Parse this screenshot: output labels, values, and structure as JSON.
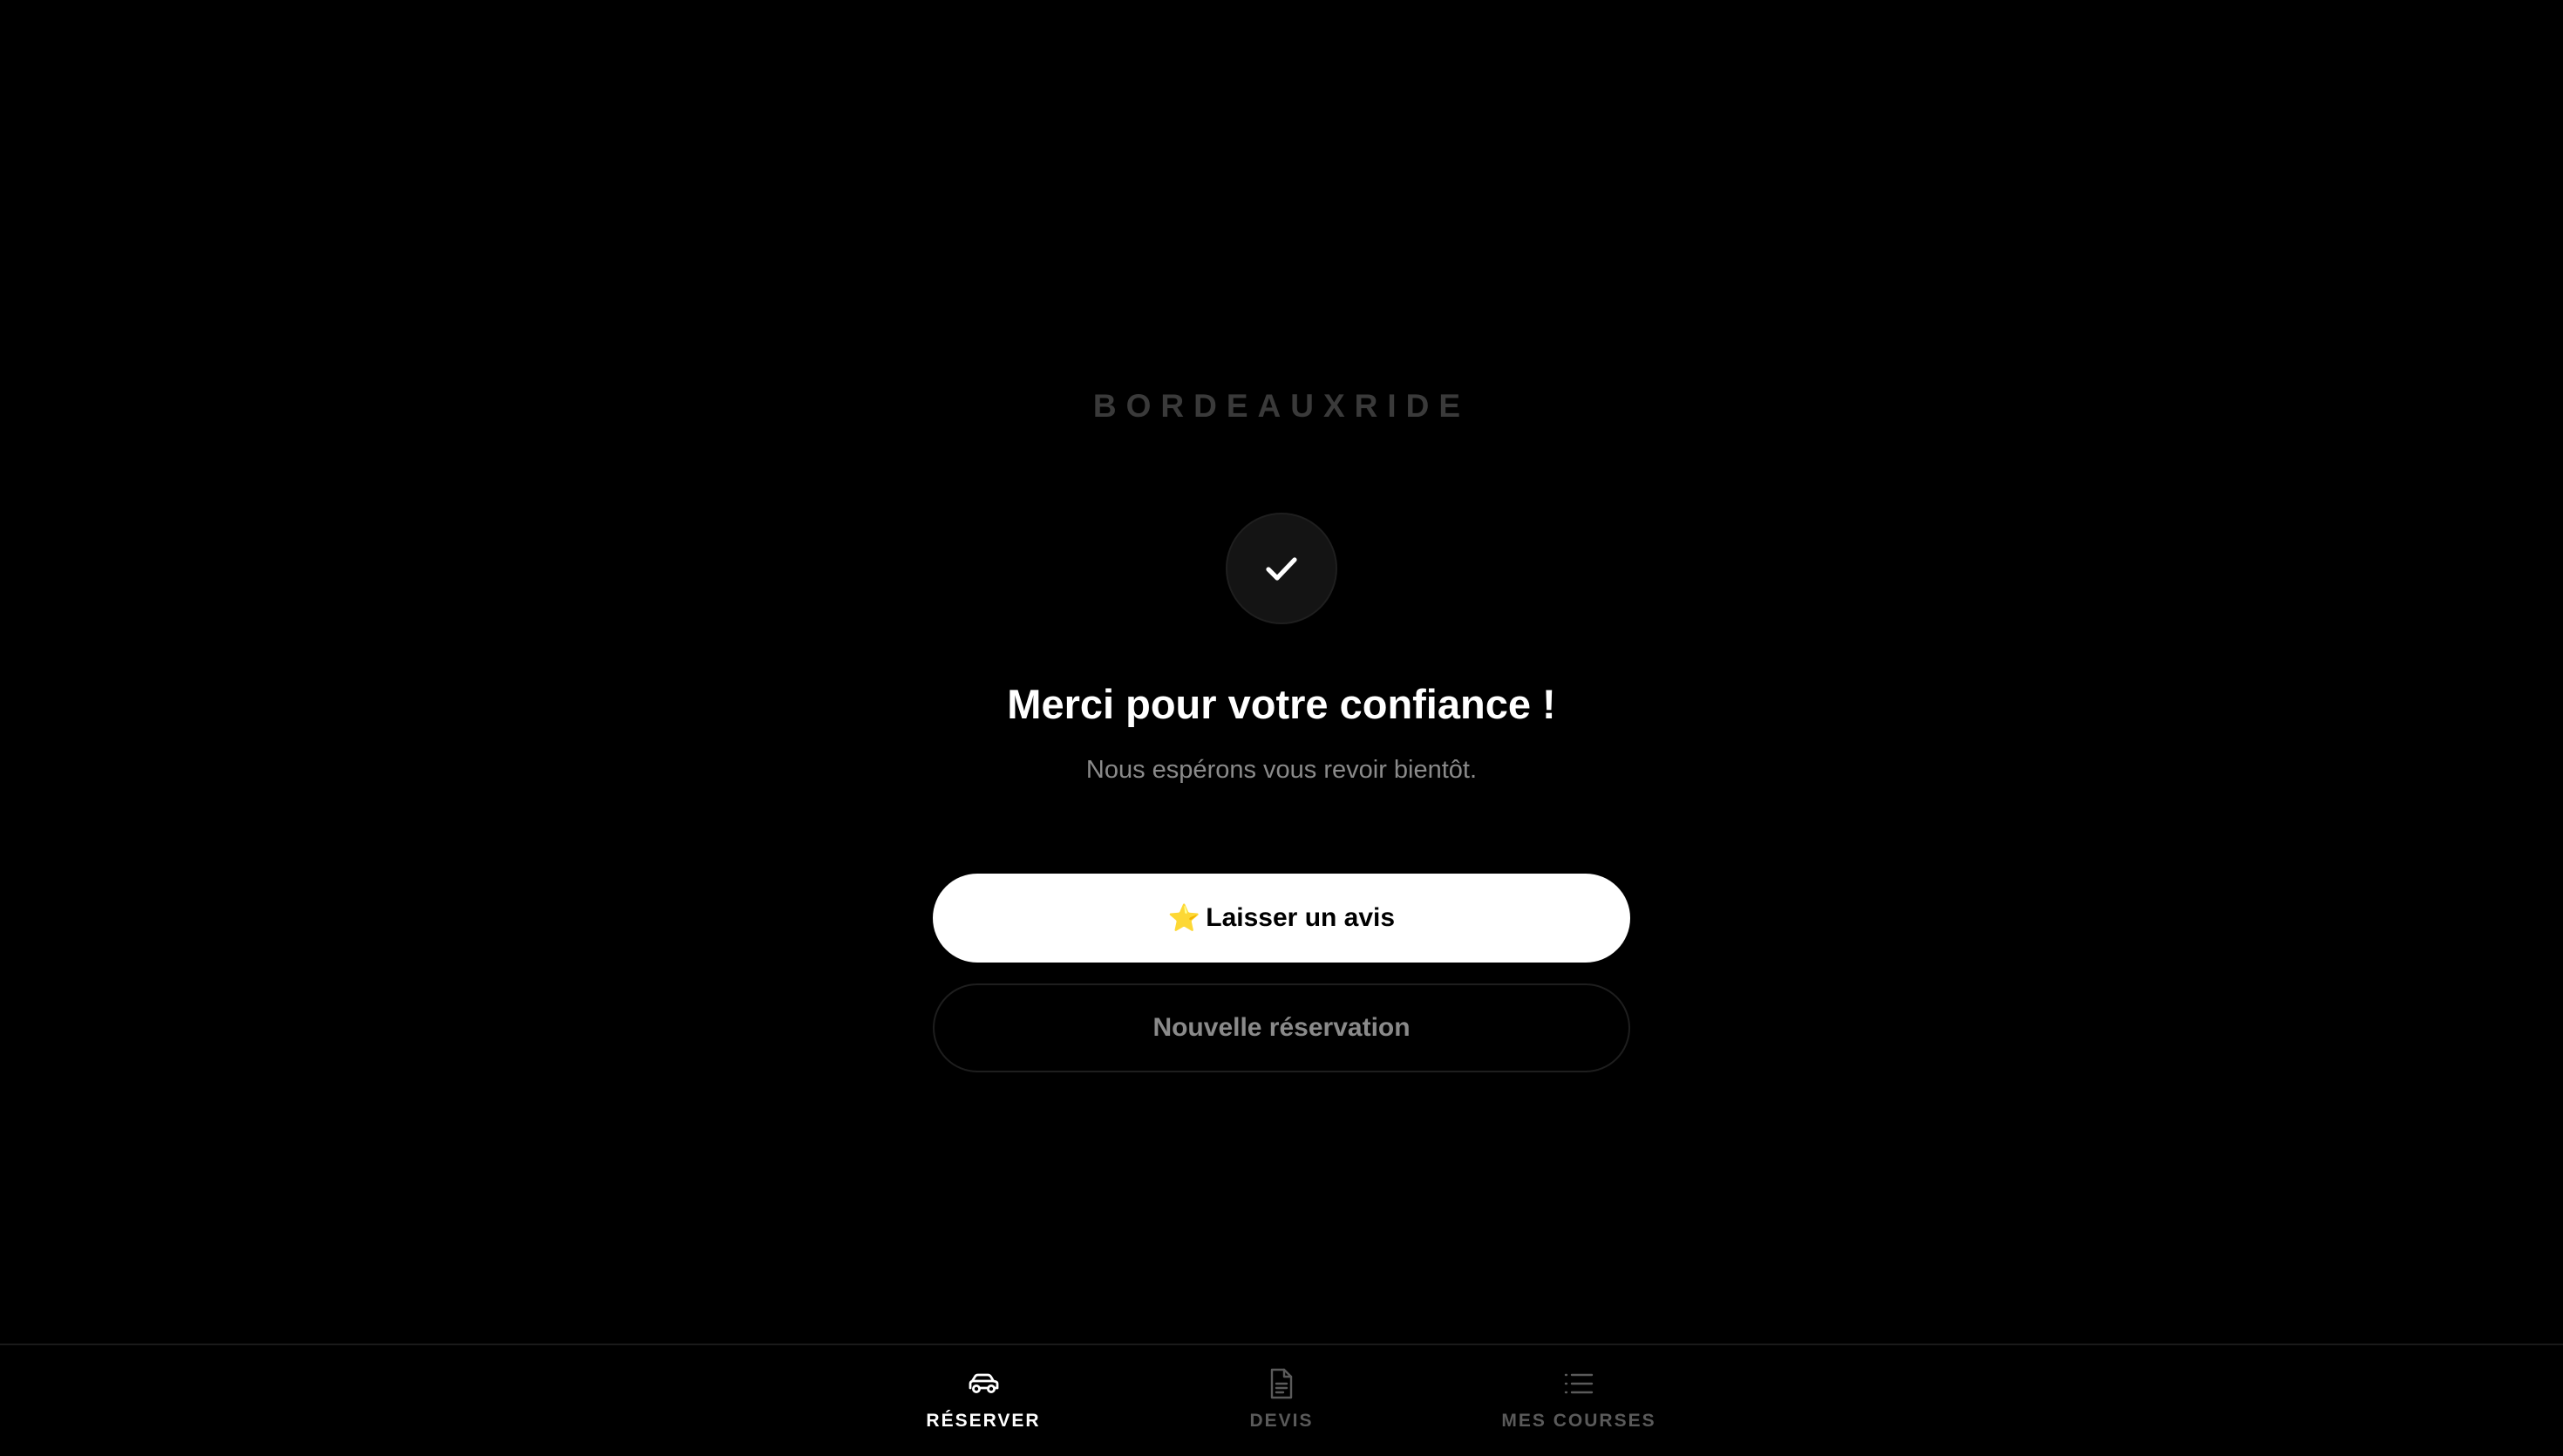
{
  "brand": {
    "name": "BORDEAUXRIDE"
  },
  "confirmation": {
    "icon": "check-icon",
    "title": "Merci pour votre confiance !",
    "subtitle": "Nous espérons vous revoir bientôt."
  },
  "actions": {
    "review_icon": "⭐",
    "review_label": "Laisser un avis",
    "new_booking_label": "Nouvelle réservation"
  },
  "bottom_nav": {
    "items": [
      {
        "label": "RÉSERVER",
        "icon": "car-icon",
        "active": true
      },
      {
        "label": "DEVIS",
        "icon": "document-icon",
        "active": false
      },
      {
        "label": "MES COURSES",
        "icon": "list-icon",
        "active": false
      }
    ]
  },
  "colors": {
    "background": "#000000",
    "accent": "#ffffff",
    "muted": "#8a8a8a",
    "inactive": "#5a5a5a"
  }
}
